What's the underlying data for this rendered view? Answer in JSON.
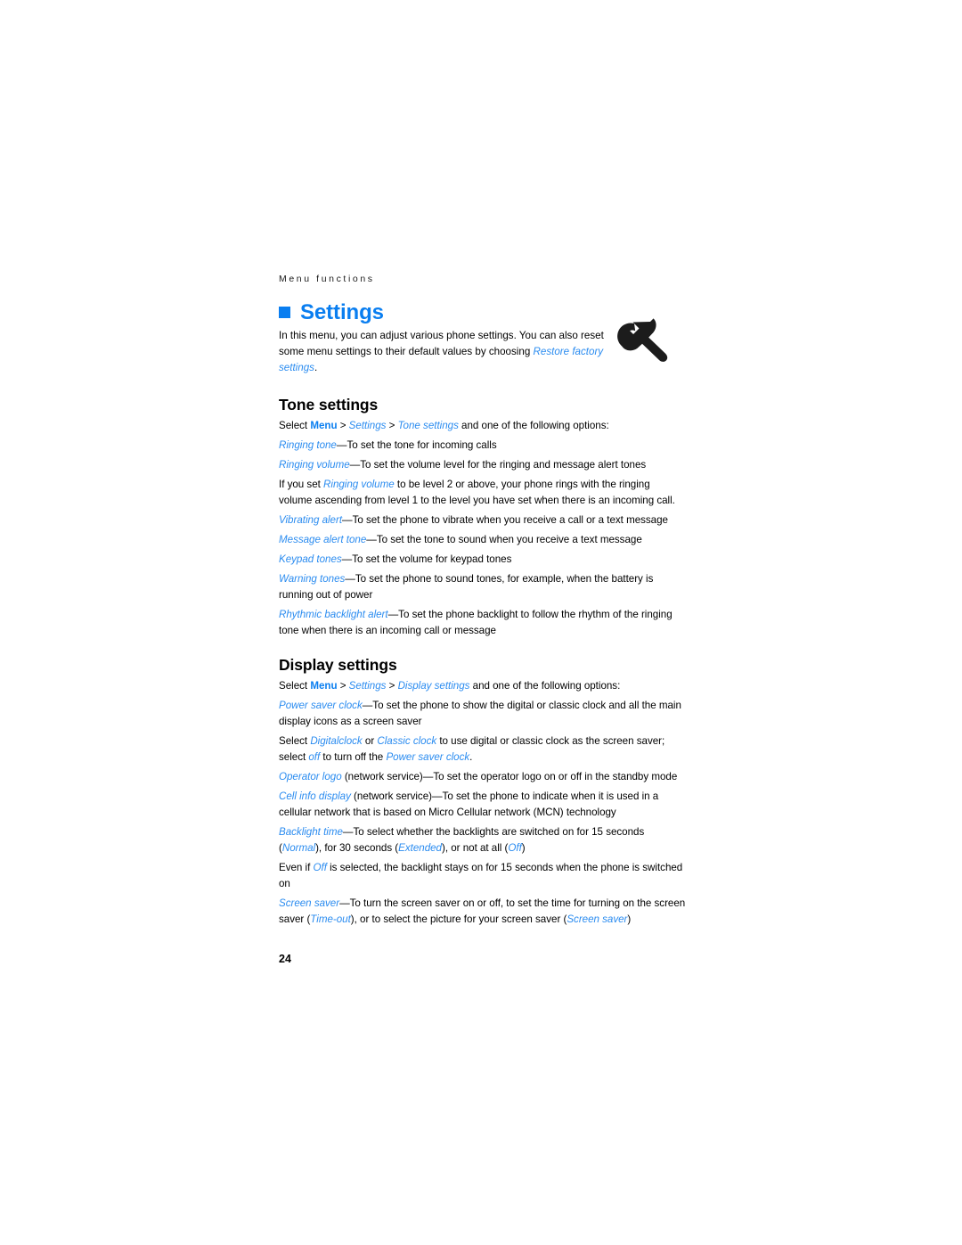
{
  "page": {
    "running_header": "Menu functions",
    "page_number": "24",
    "accent_color": "#0a7ef0",
    "term_color": "#2b8cf0",
    "text_color": "#000000",
    "background_color": "#ffffff"
  },
  "chapter": {
    "bullet_icon": "square-bullet-icon",
    "title": "Settings",
    "illustration_icon": "wrench-icon",
    "intro": {
      "part1": "In this menu, you can adjust various phone settings. You can also reset some menu settings to their default values by choosing ",
      "term1": "Restore factory settings",
      "part2": "."
    }
  },
  "sections": [
    {
      "heading": "Tone settings",
      "select_line": {
        "prefix": "Select ",
        "menu": "Menu",
        "sep1": " > ",
        "path1": "Settings",
        "sep2": " > ",
        "path2": "Tone settings",
        "suffix": " and one of the following options:"
      },
      "paragraphs": [
        {
          "term": "Ringing tone",
          "text": "—To set the tone for incoming calls"
        },
        {
          "term": "Ringing volume",
          "text": "—To set the volume level for the ringing and message alert tones"
        },
        {
          "prefix": "If you set ",
          "term": "Ringing volume",
          "text": " to be level 2 or above, your phone rings with the ringing volume ascending from level 1 to the level you have set when there is an incoming call."
        },
        {
          "term": "Vibrating alert",
          "text": "—To set the phone to vibrate when you receive a call or a text message"
        },
        {
          "term": "Message alert tone",
          "text": "—To set the tone to sound when you receive a text message"
        },
        {
          "term": "Keypad tones",
          "text": "—To set the volume for keypad tones"
        },
        {
          "term": "Warning tones",
          "text": "—To set the phone to sound tones, for example, when the battery is running out of power"
        },
        {
          "term": "Rhythmic backlight alert",
          "text": "—To set the phone backlight to follow the rhythm of the ringing tone when there is an incoming call or message"
        }
      ]
    },
    {
      "heading": "Display settings",
      "select_line": {
        "prefix": "Select ",
        "menu": "Menu",
        "sep1": " > ",
        "path1": "Settings",
        "sep2": " > ",
        "path2": "Display settings",
        "suffix": " and one of the following options:"
      },
      "paragraphs": [
        {
          "term": "Power saver clock",
          "text": "—To set the phone to show the digital or classic clock and all the main display icons as a screen saver"
        },
        {
          "prefix": "Select ",
          "term": "Digitalclock",
          "mid1": " or ",
          "term2": "Classic clock",
          "mid2": " to use digital or classic clock as the screen saver; select ",
          "term3": "off",
          "mid3": " to turn off the ",
          "term4": "Power saver clock",
          "suffix": "."
        },
        {
          "term": "Operator logo",
          "text": " (network service)—To set the operator logo on or off in the standby mode"
        },
        {
          "term": "Cell info display",
          "text": " (network service)—To set the phone to indicate when it is used in a cellular network that is based on Micro Cellular network (MCN) technology"
        },
        {
          "term": "Backlight time",
          "mid1": "—To select whether the backlights are switched on for 15 seconds (",
          "term2": "Normal",
          "mid2": "), for 30 seconds (",
          "term3": "Extended",
          "mid3": "), or not at all (",
          "term4": "Off",
          "suffix": ")"
        },
        {
          "prefix": "Even if ",
          "term": "Off",
          "text": " is selected, the backlight stays on for 15 seconds when the phone is switched on"
        },
        {
          "term": "Screen saver",
          "mid1": "—To turn the screen saver on or off, to set the time for turning on the screen saver (",
          "term2": "Time-out",
          "mid2": "), or to select the picture for your screen saver (",
          "term3": "Screen saver",
          "suffix": ")"
        }
      ]
    }
  ]
}
